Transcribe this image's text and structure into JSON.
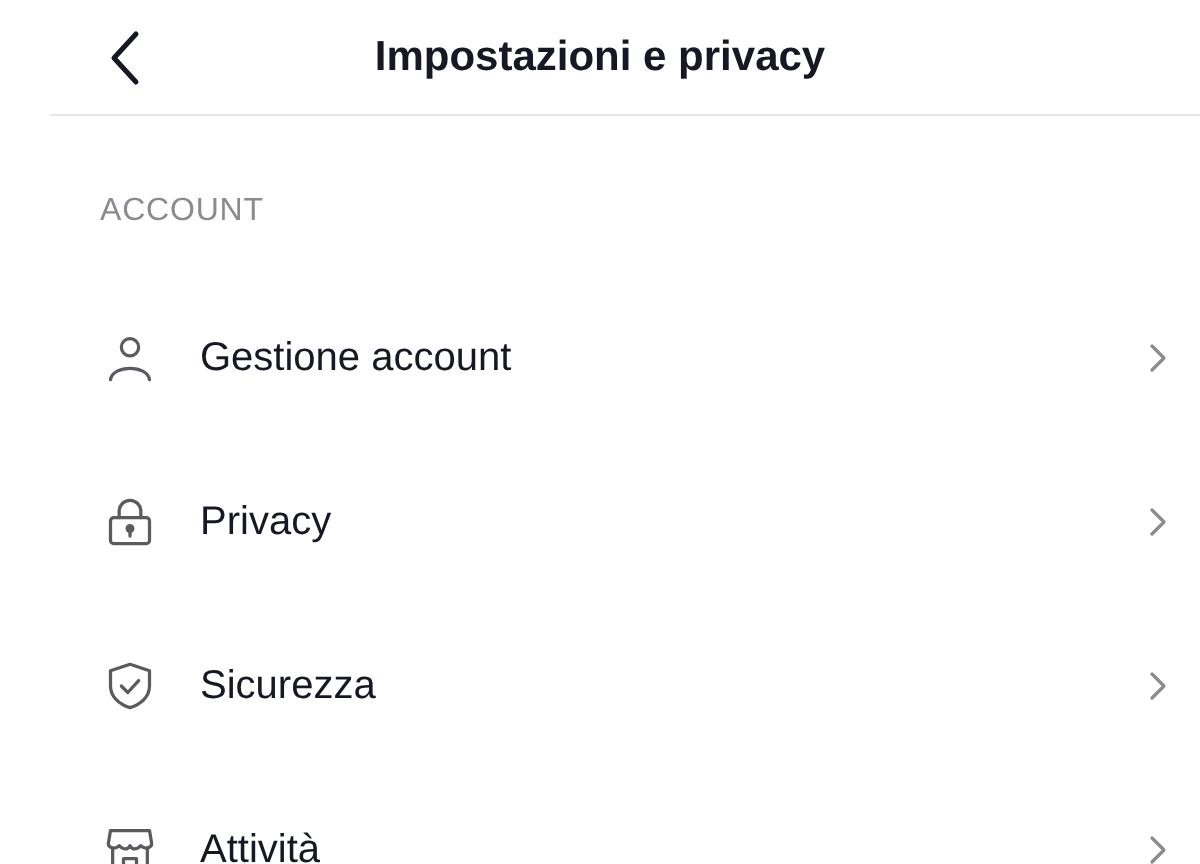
{
  "header": {
    "title": "Impostazioni e privacy"
  },
  "section": {
    "heading": "ACCOUNT",
    "items": [
      {
        "label": "Gestione account"
      },
      {
        "label": "Privacy"
      },
      {
        "label": "Sicurezza"
      },
      {
        "label": "Attività"
      }
    ]
  }
}
